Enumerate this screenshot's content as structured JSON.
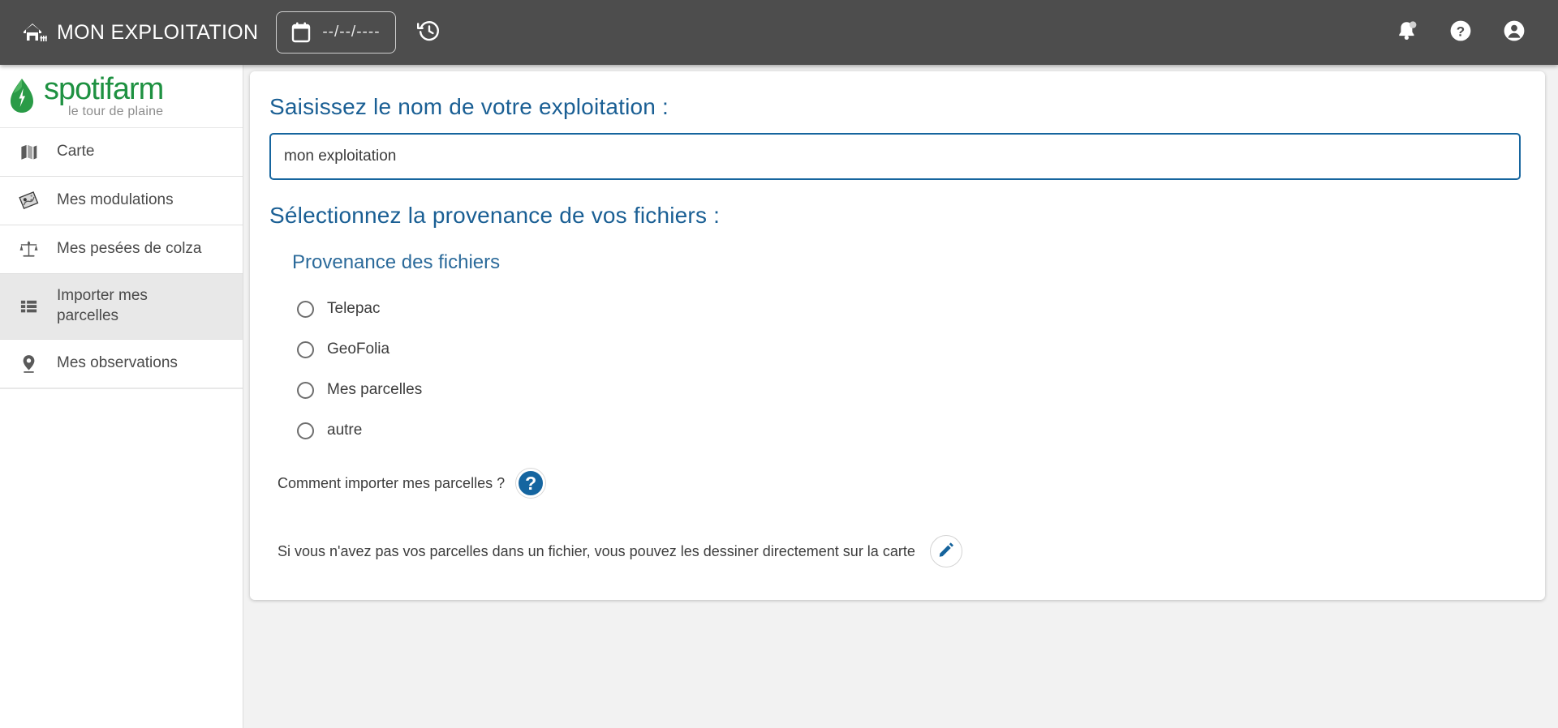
{
  "topbar": {
    "farm_icon": "barn-icon",
    "title": "MON EXPLOITATION",
    "date_picker": {
      "icon": "calendar-icon",
      "value": "--/--/----"
    },
    "history_icon": "history-icon",
    "actions": [
      {
        "name": "notifications-icon",
        "glyph": "bell"
      },
      {
        "name": "help-icon",
        "glyph": "question"
      },
      {
        "name": "account-icon",
        "glyph": "person"
      }
    ],
    "bg_color": "#4d4d4d"
  },
  "sidebar": {
    "logo": {
      "icon": "leaf-icon",
      "word": "spotifarm",
      "tagline": "le tour de plaine",
      "color": "#1e9141"
    },
    "items": [
      {
        "label": "Carte",
        "icon": "map-icon",
        "active": false
      },
      {
        "label": "Mes modulations",
        "icon": "modulation-map-icon",
        "active": false
      },
      {
        "label": "Mes pesées de colza",
        "icon": "balance-scale-icon",
        "active": false
      },
      {
        "label": "Importer mes parcelles",
        "icon": "list-icon",
        "active": true
      },
      {
        "label": "Mes observations",
        "icon": "location-pin-icon",
        "active": false
      }
    ],
    "active_bg": "#e8e8e8"
  },
  "main": {
    "name_section": {
      "heading": "Saisissez le nom de votre exploitation :",
      "input_value": "mon exploitation",
      "input_placeholder": "",
      "border_color": "#16659e"
    },
    "source_section": {
      "heading": "Sélectionnez la provenance de vos fichiers :",
      "group_title": "Provenance des fichiers",
      "options": [
        {
          "label": "Telepac",
          "selected": false
        },
        {
          "label": "GeoFolia",
          "selected": false
        },
        {
          "label": "Mes parcelles",
          "selected": false
        },
        {
          "label": "autre",
          "selected": false
        }
      ]
    },
    "help": {
      "how_to_import_text": "Comment importer mes parcelles ?",
      "how_to_import_icon": "question-mark-icon",
      "draw_on_map_text": "Si vous n'avez pas vos parcelles dans un fichier, vous pouvez les dessiner directement sur la carte",
      "draw_on_map_icon": "pencil-icon"
    },
    "accent_color": "#1a5f94",
    "background": "#f2f2f2"
  }
}
